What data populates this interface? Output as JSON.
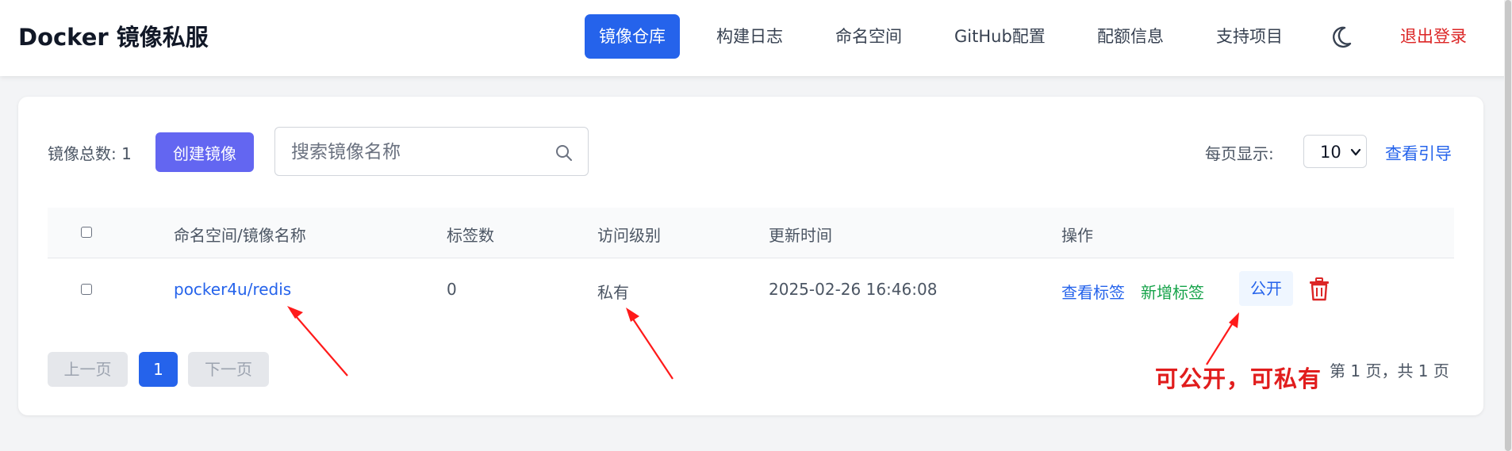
{
  "header": {
    "brand": "Docker 镜像私服",
    "nav": [
      {
        "label": "镜像仓库",
        "active": true
      },
      {
        "label": "构建日志"
      },
      {
        "label": "命名空间"
      },
      {
        "label": "GitHub配置"
      },
      {
        "label": "配额信息"
      },
      {
        "label": "支持项目"
      }
    ],
    "theme_icon": "moon-icon",
    "logout": "退出登录"
  },
  "toolbar": {
    "total_label": "镜像总数: 1",
    "create_button": "创建镜像",
    "search_placeholder": "搜索镜像名称",
    "search_icon": "search-icon",
    "per_page_label": "每页显示:",
    "per_page_value": "10",
    "guide_link": "查看引导"
  },
  "table": {
    "columns": [
      "命名空间/镜像名称",
      "标签数",
      "访问级别",
      "更新时间",
      "操作"
    ],
    "rows": [
      {
        "name": "pocker4u/redis",
        "tag_count": "0",
        "access": "私有",
        "updated": "2025-02-26 16:46:08",
        "actions": {
          "view_tags": "查看标签",
          "add_tag": "新增标签",
          "toggle_visibility": "公开",
          "delete_icon": "trash-icon"
        }
      }
    ]
  },
  "pagination": {
    "prev": "上一页",
    "current": "1",
    "next": "下一页",
    "info": "第 1 页，共 1 页"
  },
  "annotation": {
    "text": "可公开，可私有",
    "color": "#e11d1d"
  },
  "colors": {
    "primary": "#2563eb",
    "indigo": "#6366f1",
    "green": "#16a34a",
    "danger": "#dc2626"
  }
}
